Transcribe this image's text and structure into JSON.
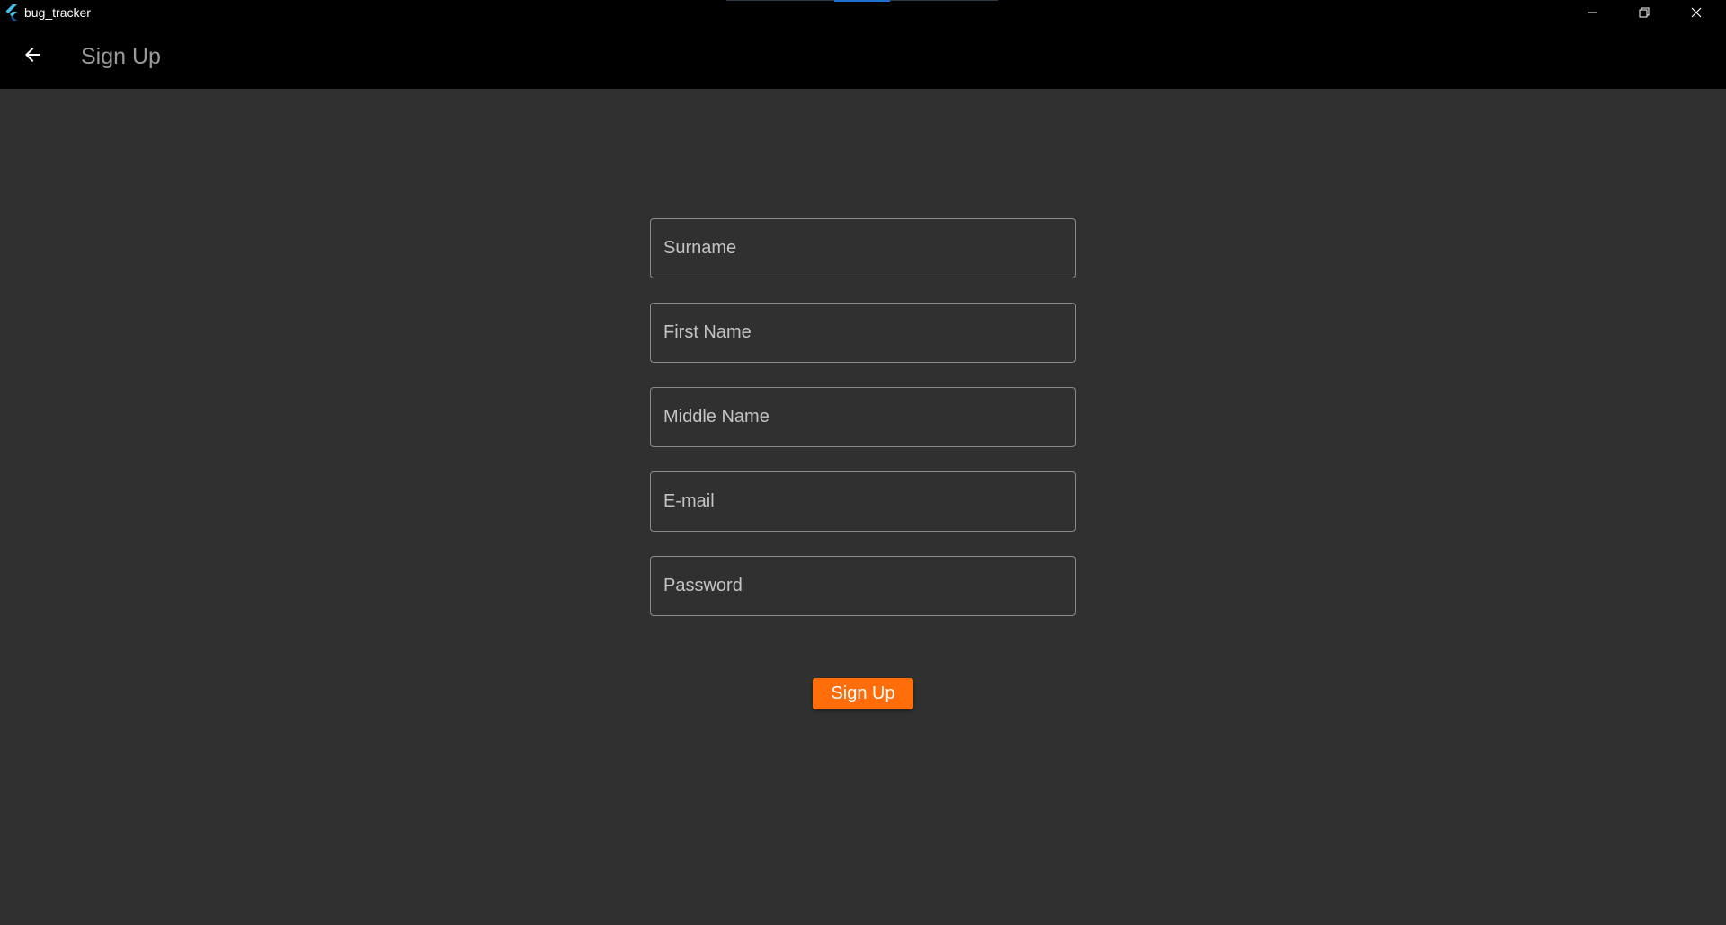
{
  "window": {
    "title": "bug_tracker",
    "app_icon": "flutter-logo-icon",
    "controls": {
      "minimize_icon": "minimize-icon",
      "restore_icon": "restore-icon",
      "close_icon": "close-icon"
    }
  },
  "appbar": {
    "back_icon": "arrow-left-icon",
    "title": "Sign Up"
  },
  "form": {
    "fields": [
      {
        "name": "surname",
        "placeholder": "Surname",
        "value": ""
      },
      {
        "name": "first_name",
        "placeholder": "First Name",
        "value": ""
      },
      {
        "name": "middle_name",
        "placeholder": "Middle Name",
        "value": ""
      },
      {
        "name": "email",
        "placeholder": "E-mail",
        "value": ""
      },
      {
        "name": "password",
        "placeholder": "Password",
        "value": ""
      }
    ],
    "submit_label": "Sign Up"
  },
  "colors": {
    "background": "#303030",
    "appbar": "#000000",
    "accent": "#ff6d0a",
    "field_border": "#8a8a8a",
    "placeholder": "#c4c4c4"
  }
}
